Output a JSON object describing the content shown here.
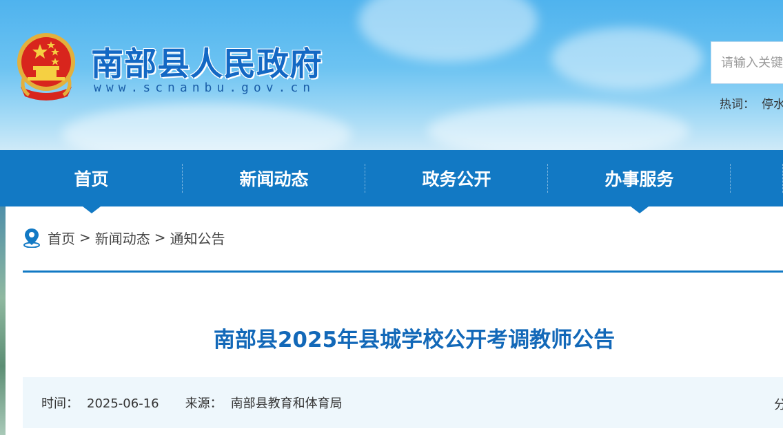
{
  "header": {
    "site_title": "南部县人民政府",
    "site_url": "www.scnanbu.gov.cn",
    "search_placeholder": "请输入关键",
    "hot_words_label": "热词：",
    "hot_words": [
      "停水"
    ],
    "colors": {
      "title": "#1368c4",
      "nav_bg": "#1279c4"
    }
  },
  "nav": {
    "items": [
      {
        "label": "首页",
        "active": true
      },
      {
        "label": "新闻动态",
        "active": false
      },
      {
        "label": "政务公开",
        "active": false
      },
      {
        "label": "办事服务",
        "active": true
      }
    ]
  },
  "breadcrumb": {
    "icon": "location-pin-icon",
    "items": [
      "首页",
      "新闻动态",
      "通知公告"
    ],
    "separator": ">"
  },
  "article": {
    "title": "南部县2025年县城学校公开考调教师公告",
    "meta": {
      "time_label": "时间：",
      "time_value": "2025-06-16",
      "source_label": "来源：",
      "source_value": "南部县教育和体育局",
      "share_label": "分"
    }
  }
}
